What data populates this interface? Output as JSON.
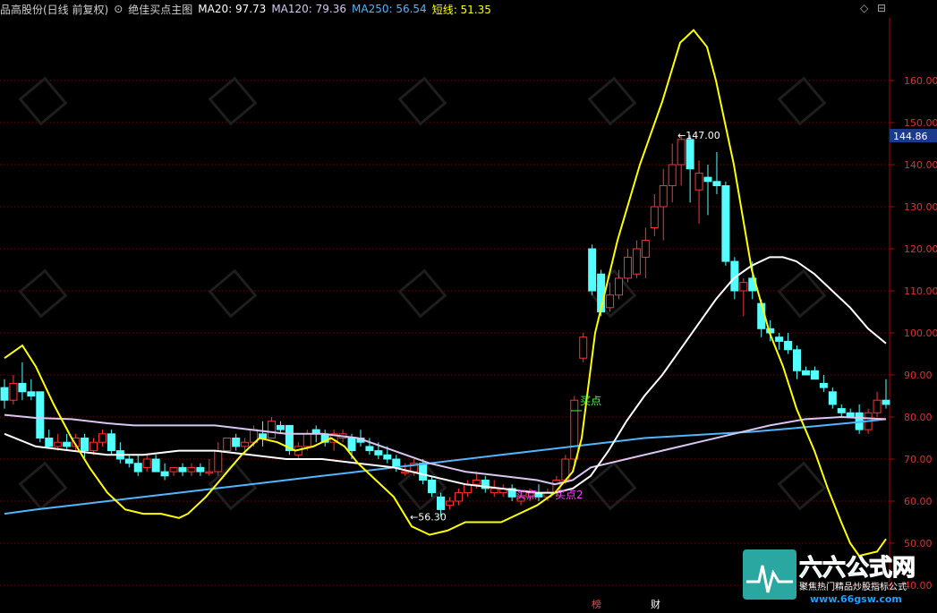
{
  "header": {
    "stock": "品高股份(日线 前复权)",
    "indicator_toggle": "⊙",
    "indicator": "绝佳买点主图",
    "ma20": "MA20: 97.73",
    "ma120": "MA120: 79.36",
    "ma250": "MA250: 56.54",
    "short": "短线: 51.35"
  },
  "colors": {
    "up": "#ff3232",
    "down": "#54ffff",
    "grid": "#7a0000",
    "axis": "#b40000",
    "ma20": "#ffffff",
    "ma120": "#d9c6f2",
    "ma250": "#4fb6ff",
    "short": "#ffff00",
    "axisText": "#e03030",
    "priceBox": "#1c3a8c"
  },
  "window_controls": {
    "diamond": "◇",
    "restore": "⊟"
  },
  "current_price": "144.86",
  "bottom_labels": [
    "榜",
    "财"
  ],
  "watermark": {
    "brand": "六六公式网",
    "slogan": "聚焦热门精品炒股指标公式",
    "url": "www.66gsw.com"
  },
  "chart_data": {
    "type": "candlestick",
    "yaxis": {
      "ticks": [
        40,
        50,
        60,
        70,
        80,
        90,
        100,
        110,
        120,
        130,
        140,
        150,
        160
      ],
      "range": [
        40,
        173
      ]
    },
    "annotations": [
      {
        "text": "147.00",
        "kind": "high"
      },
      {
        "text": "56.30",
        "kind": "low"
      },
      {
        "text": "买点",
        "kind": "buy"
      },
      {
        "text": "买点",
        "kind": "buy"
      },
      {
        "text": "买点2",
        "kind": "buy2"
      }
    ],
    "candles": [
      {
        "o": 87,
        "h": 89,
        "l": 82,
        "c": 84
      },
      {
        "o": 84,
        "h": 90,
        "l": 83,
        "c": 88
      },
      {
        "o": 88,
        "h": 93,
        "l": 84,
        "c": 86
      },
      {
        "o": 86,
        "h": 89,
        "l": 84,
        "c": 85
      },
      {
        "o": 86,
        "h": 86,
        "l": 74,
        "c": 75
      },
      {
        "o": 75,
        "h": 77,
        "l": 73,
        "c": 73
      },
      {
        "o": 73,
        "h": 76,
        "l": 72,
        "c": 74
      },
      {
        "o": 74,
        "h": 76,
        "l": 72,
        "c": 73
      },
      {
        "o": 73,
        "h": 76,
        "l": 72,
        "c": 75
      },
      {
        "o": 75,
        "h": 76,
        "l": 70,
        "c": 72
      },
      {
        "o": 72,
        "h": 75,
        "l": 71,
        "c": 74
      },
      {
        "o": 74,
        "h": 77,
        "l": 73,
        "c": 76
      },
      {
        "o": 76,
        "h": 77,
        "l": 71,
        "c": 72
      },
      {
        "o": 72,
        "h": 74,
        "l": 69,
        "c": 70
      },
      {
        "o": 70,
        "h": 71,
        "l": 68,
        "c": 69
      },
      {
        "o": 69,
        "h": 71,
        "l": 66,
        "c": 67
      },
      {
        "o": 68,
        "h": 71,
        "l": 67,
        "c": 70
      },
      {
        "o": 70,
        "h": 71,
        "l": 67,
        "c": 67
      },
      {
        "o": 67,
        "h": 69,
        "l": 65,
        "c": 66
      },
      {
        "o": 67,
        "h": 68,
        "l": 66,
        "c": 68
      },
      {
        "o": 68,
        "h": 69,
        "l": 66,
        "c": 67
      },
      {
        "o": 67,
        "h": 69,
        "l": 66,
        "c": 68
      },
      {
        "o": 68,
        "h": 69,
        "l": 66,
        "c": 67
      },
      {
        "o": 67,
        "h": 70,
        "l": 66,
        "c": 67
      },
      {
        "o": 67,
        "h": 74,
        "l": 66,
        "c": 72
      },
      {
        "o": 72,
        "h": 75,
        "l": 72,
        "c": 75
      },
      {
        "o": 75,
        "h": 76,
        "l": 72,
        "c": 73
      },
      {
        "o": 73,
        "h": 75,
        "l": 72,
        "c": 74
      },
      {
        "o": 74,
        "h": 78,
        "l": 73,
        "c": 77
      },
      {
        "o": 76,
        "h": 79,
        "l": 73,
        "c": 75
      },
      {
        "o": 75,
        "h": 80,
        "l": 75,
        "c": 79
      },
      {
        "o": 78,
        "h": 79,
        "l": 76,
        "c": 77
      },
      {
        "o": 78,
        "h": 78,
        "l": 71,
        "c": 72
      },
      {
        "o": 71,
        "h": 74,
        "l": 70,
        "c": 73
      },
      {
        "o": 73,
        "h": 77,
        "l": 72,
        "c": 76
      },
      {
        "o": 77,
        "h": 78,
        "l": 74,
        "c": 76
      },
      {
        "o": 76,
        "h": 77,
        "l": 73,
        "c": 74
      },
      {
        "o": 74,
        "h": 77,
        "l": 72,
        "c": 76
      },
      {
        "o": 75,
        "h": 77,
        "l": 74,
        "c": 76
      },
      {
        "o": 75,
        "h": 76,
        "l": 70,
        "c": 72
      },
      {
        "o": 75,
        "h": 77,
        "l": 73,
        "c": 74
      },
      {
        "o": 73,
        "h": 75,
        "l": 71,
        "c": 72
      },
      {
        "o": 72,
        "h": 74,
        "l": 70,
        "c": 71
      },
      {
        "o": 71,
        "h": 73,
        "l": 69,
        "c": 70
      },
      {
        "o": 70,
        "h": 71,
        "l": 67,
        "c": 68
      },
      {
        "o": 67,
        "h": 69,
        "l": 66,
        "c": 67
      },
      {
        "o": 67,
        "h": 70,
        "l": 66,
        "c": 69
      },
      {
        "o": 69,
        "h": 70,
        "l": 64,
        "c": 65
      },
      {
        "o": 65,
        "h": 66,
        "l": 61,
        "c": 62
      },
      {
        "o": 61,
        "h": 62,
        "l": 56.3,
        "c": 58
      },
      {
        "o": 59,
        "h": 61,
        "l": 58,
        "c": 60
      },
      {
        "o": 60,
        "h": 63,
        "l": 59,
        "c": 62
      },
      {
        "o": 62,
        "h": 65,
        "l": 61,
        "c": 64
      },
      {
        "o": 64,
        "h": 67,
        "l": 63,
        "c": 65
      },
      {
        "o": 65,
        "h": 66,
        "l": 62,
        "c": 63
      },
      {
        "o": 62,
        "h": 65,
        "l": 61,
        "c": 63
      },
      {
        "o": 62,
        "h": 64,
        "l": 61,
        "c": 63
      },
      {
        "o": 63,
        "h": 64,
        "l": 60,
        "c": 61
      },
      {
        "o": 60,
        "h": 62,
        "l": 59,
        "c": 61
      },
      {
        "o": 61,
        "h": 63,
        "l": 60,
        "c": 62
      },
      {
        "o": 62,
        "h": 64,
        "l": 60,
        "c": 61
      },
      {
        "o": 61,
        "h": 63,
        "l": 60,
        "c": 62
      },
      {
        "o": 62,
        "h": 66,
        "l": 61,
        "c": 65
      },
      {
        "o": 65,
        "h": 71,
        "l": 64,
        "c": 70
      },
      {
        "o": 70,
        "h": 85,
        "l": 69,
        "c": 84
      },
      {
        "o": 94,
        "h": 100,
        "l": 93,
        "c": 99
      },
      {
        "o": 120,
        "h": 121,
        "l": 109,
        "c": 110
      },
      {
        "o": 114,
        "h": 115,
        "l": 104,
        "c": 105
      },
      {
        "o": 106,
        "h": 112,
        "l": 105,
        "c": 109
      },
      {
        "o": 109,
        "h": 115,
        "l": 108,
        "c": 113
      },
      {
        "o": 113,
        "h": 120,
        "l": 112,
        "c": 118
      },
      {
        "o": 114,
        "h": 122,
        "l": 113,
        "c": 120
      },
      {
        "o": 118,
        "h": 125,
        "l": 113,
        "c": 122
      },
      {
        "o": 125,
        "h": 133,
        "l": 123,
        "c": 130
      },
      {
        "o": 130,
        "h": 139,
        "l": 122,
        "c": 135
      },
      {
        "o": 135,
        "h": 145,
        "l": 131,
        "c": 140
      },
      {
        "o": 140,
        "h": 147,
        "l": 135,
        "c": 146
      },
      {
        "o": 146,
        "h": 147,
        "l": 131,
        "c": 139
      },
      {
        "o": 134,
        "h": 141,
        "l": 126,
        "c": 138
      },
      {
        "o": 137,
        "h": 140,
        "l": 128,
        "c": 136
      },
      {
        "o": 136,
        "h": 143,
        "l": 133,
        "c": 135
      },
      {
        "o": 135,
        "h": 136,
        "l": 116,
        "c": 117
      },
      {
        "o": 117,
        "h": 118,
        "l": 108,
        "c": 110
      },
      {
        "o": 110,
        "h": 113,
        "l": 104,
        "c": 112
      },
      {
        "o": 113,
        "h": 117,
        "l": 108,
        "c": 110
      },
      {
        "o": 107,
        "h": 108,
        "l": 99,
        "c": 101
      },
      {
        "o": 101,
        "h": 103,
        "l": 98,
        "c": 100
      },
      {
        "o": 99,
        "h": 100,
        "l": 96,
        "c": 98
      },
      {
        "o": 98,
        "h": 100,
        "l": 95,
        "c": 96
      },
      {
        "o": 96,
        "h": 97,
        "l": 89,
        "c": 91
      },
      {
        "o": 91,
        "h": 92,
        "l": 90,
        "c": 90
      },
      {
        "o": 91,
        "h": 92,
        "l": 89,
        "c": 89
      },
      {
        "o": 88,
        "h": 90,
        "l": 86,
        "c": 87
      },
      {
        "o": 86,
        "h": 87,
        "l": 82,
        "c": 83
      },
      {
        "o": 82,
        "h": 83,
        "l": 80,
        "c": 81
      },
      {
        "o": 81,
        "h": 82,
        "l": 80,
        "c": 80
      },
      {
        "o": 81,
        "h": 83,
        "l": 76,
        "c": 77
      },
      {
        "o": 77,
        "h": 82,
        "l": 76,
        "c": 81
      },
      {
        "o": 81,
        "h": 86,
        "l": 80,
        "c": 84
      },
      {
        "o": 84,
        "h": 89,
        "l": 82,
        "c": 83
      }
    ],
    "ma20": [
      [
        5,
        76
      ],
      [
        40,
        73
      ],
      [
        80,
        72
      ],
      [
        120,
        71
      ],
      [
        160,
        71
      ],
      [
        200,
        72
      ],
      [
        240,
        72
      ],
      [
        280,
        71
      ],
      [
        320,
        70
      ],
      [
        360,
        70
      ],
      [
        400,
        69
      ],
      [
        440,
        68
      ],
      [
        480,
        66
      ],
      [
        520,
        64
      ],
      [
        560,
        63
      ],
      [
        600,
        62
      ],
      [
        620,
        62
      ],
      [
        640,
        63
      ],
      [
        660,
        66
      ],
      [
        680,
        72
      ],
      [
        700,
        79
      ],
      [
        720,
        85
      ],
      [
        740,
        90
      ],
      [
        760,
        96
      ],
      [
        780,
        102
      ],
      [
        800,
        108
      ],
      [
        820,
        113
      ],
      [
        840,
        116
      ],
      [
        860,
        118
      ],
      [
        875,
        118
      ],
      [
        890,
        117
      ],
      [
        910,
        114
      ],
      [
        930,
        110
      ],
      [
        950,
        106
      ],
      [
        970,
        101
      ],
      [
        990,
        97.5
      ]
    ],
    "ma120": [
      [
        5,
        80.5
      ],
      [
        40,
        79.8
      ],
      [
        80,
        79.5
      ],
      [
        120,
        78.5
      ],
      [
        150,
        78
      ],
      [
        200,
        78
      ],
      [
        240,
        78
      ],
      [
        280,
        77
      ],
      [
        320,
        76
      ],
      [
        360,
        76
      ],
      [
        400,
        75
      ],
      [
        440,
        72
      ],
      [
        480,
        69
      ],
      [
        520,
        67
      ],
      [
        560,
        66
      ],
      [
        600,
        65
      ],
      [
        620,
        64
      ],
      [
        640,
        65
      ],
      [
        660,
        68
      ],
      [
        700,
        70
      ],
      [
        740,
        72
      ],
      [
        780,
        74
      ],
      [
        820,
        76
      ],
      [
        860,
        78
      ],
      [
        900,
        79.5
      ],
      [
        940,
        80
      ],
      [
        990,
        79.5
      ]
    ],
    "ma250": [
      [
        5,
        57
      ],
      [
        40,
        58
      ],
      [
        80,
        59
      ],
      [
        120,
        60
      ],
      [
        160,
        61
      ],
      [
        200,
        62
      ],
      [
        240,
        63
      ],
      [
        280,
        64
      ],
      [
        320,
        65
      ],
      [
        360,
        66
      ],
      [
        400,
        67
      ],
      [
        440,
        68
      ],
      [
        480,
        69
      ],
      [
        520,
        70
      ],
      [
        560,
        71
      ],
      [
        600,
        72
      ],
      [
        640,
        73
      ],
      [
        680,
        74
      ],
      [
        720,
        75
      ],
      [
        760,
        75.5
      ],
      [
        800,
        76
      ],
      [
        840,
        76.5
      ],
      [
        880,
        77.2
      ],
      [
        920,
        78
      ],
      [
        960,
        78.8
      ],
      [
        990,
        79.5
      ]
    ],
    "short": [
      [
        5,
        94
      ],
      [
        25,
        97
      ],
      [
        40,
        92
      ],
      [
        60,
        83
      ],
      [
        80,
        75
      ],
      [
        100,
        68
      ],
      [
        120,
        62
      ],
      [
        140,
        58
      ],
      [
        160,
        57
      ],
      [
        180,
        57
      ],
      [
        200,
        56
      ],
      [
        210,
        57
      ],
      [
        230,
        61
      ],
      [
        250,
        66
      ],
      [
        270,
        71
      ],
      [
        290,
        75
      ],
      [
        310,
        74
      ],
      [
        330,
        72
      ],
      [
        350,
        73
      ],
      [
        370,
        75
      ],
      [
        385,
        73
      ],
      [
        400,
        69
      ],
      [
        420,
        65
      ],
      [
        440,
        61
      ],
      [
        460,
        54
      ],
      [
        480,
        52
      ],
      [
        500,
        53
      ],
      [
        520,
        55
      ],
      [
        540,
        55
      ],
      [
        560,
        55
      ],
      [
        580,
        57
      ],
      [
        600,
        59
      ],
      [
        620,
        62
      ],
      [
        640,
        67
      ],
      [
        650,
        75
      ],
      [
        665,
        100
      ],
      [
        690,
        122
      ],
      [
        715,
        140
      ],
      [
        740,
        155
      ],
      [
        760,
        169
      ],
      [
        775,
        172
      ],
      [
        790,
        168
      ],
      [
        800,
        160
      ],
      [
        820,
        140
      ],
      [
        840,
        115
      ],
      [
        860,
        100
      ],
      [
        875,
        92
      ],
      [
        890,
        82
      ],
      [
        910,
        72
      ],
      [
        925,
        63
      ],
      [
        940,
        55
      ],
      [
        950,
        50
      ],
      [
        960,
        47
      ],
      [
        980,
        48
      ],
      [
        990,
        51
      ]
    ]
  }
}
